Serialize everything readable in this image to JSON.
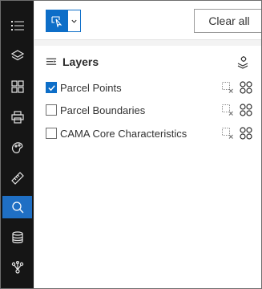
{
  "rail": {
    "items": [
      {
        "icon": "list-icon",
        "active": false
      },
      {
        "icon": "layers-icon",
        "active": false
      },
      {
        "icon": "grid-icon",
        "active": false
      },
      {
        "icon": "print-icon",
        "active": false
      },
      {
        "icon": "palette-icon",
        "active": false
      },
      {
        "icon": "measure-icon",
        "active": false
      },
      {
        "icon": "query-search-icon",
        "active": true
      },
      {
        "icon": "database-icon",
        "active": false
      },
      {
        "icon": "network-icon",
        "active": false
      }
    ]
  },
  "toolbar": {
    "clear_label": "Clear all"
  },
  "layers": {
    "title": "Layers",
    "items": [
      {
        "label": "Parcel Points",
        "checked": true
      },
      {
        "label": "Parcel Boundaries",
        "checked": false
      },
      {
        "label": "CAMA Core Characteristics",
        "checked": false
      }
    ]
  },
  "colors": {
    "accent": "#0d6ec8",
    "rail_bg": "#151515",
    "rail_active": "#1f6fc4"
  }
}
